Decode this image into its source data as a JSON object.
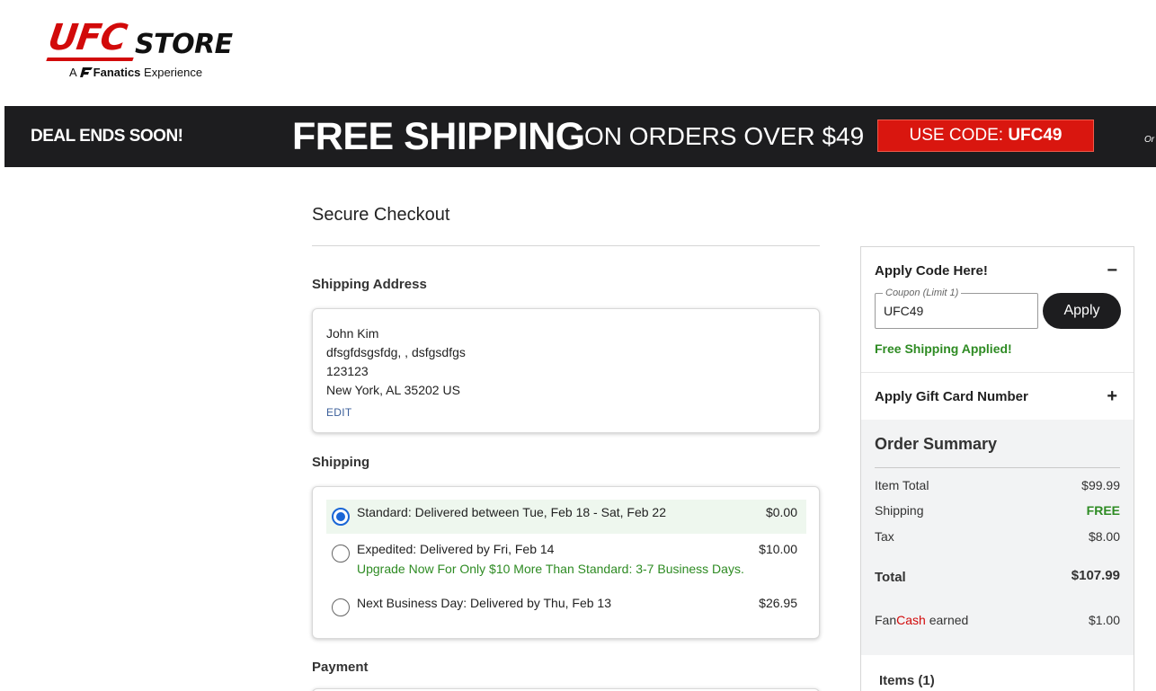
{
  "brand": {
    "logo_main": "UFC",
    "logo_store": "STORE",
    "logo_prefix": "A",
    "logo_partner": "Fanatics",
    "logo_suffix": "Experience"
  },
  "promo": {
    "deal": "DEAL ENDS SOON!",
    "headline": "FREE SHIPPING",
    "subline": "ON ORDERS OVER $49",
    "code_prefix": "USE CODE:",
    "code": "UFC49",
    "overflow_text": "Or"
  },
  "checkout": {
    "title": "Secure Checkout",
    "shipping_address_label": "Shipping Address",
    "address": {
      "name": "John Kim",
      "line1": "dfsgfdsgsfdg, , dsfgsdfgs",
      "line2": "123123",
      "city_line": "New York, AL 35202 US",
      "edit_label": "EDIT"
    },
    "shipping_label": "Shipping",
    "shipping_options": [
      {
        "label": "Standard: Delivered between Tue, Feb 18 - Sat, Feb 22",
        "price": "$0.00",
        "selected": true
      },
      {
        "label": "Expedited: Delivered by Fri, Feb 14",
        "price": "$10.00",
        "note": "Upgrade Now For Only $10 More Than Standard: 3-7 Business Days.",
        "selected": false
      },
      {
        "label": "Next Business Day: Delivered by Thu, Feb 13",
        "price": "$26.95",
        "selected": false
      }
    ],
    "payment_label": "Payment"
  },
  "sidebar": {
    "apply_code": {
      "title": "Apply Code Here!",
      "toggle": "−",
      "coupon_legend": "Coupon (Limit 1)",
      "coupon_value": "UFC49",
      "apply_label": "Apply",
      "success": "Free Shipping Applied!"
    },
    "gift_card": {
      "title": "Apply Gift Card Number",
      "toggle": "+"
    },
    "summary": {
      "title": "Order Summary",
      "item_total_label": "Item Total",
      "item_total": "$99.99",
      "shipping_label": "Shipping",
      "shipping": "FREE",
      "tax_label": "Tax",
      "tax": "$8.00",
      "total_label": "Total",
      "total": "$107.99",
      "fancash_fan": "Fan",
      "fancash_cash": "Cash",
      "fancash_earned": "earned",
      "fancash_value": "$1.00",
      "items_title": "Items (1)"
    }
  },
  "colors": {
    "brand_red": "#d20a0a",
    "banner_bg": "#1d1d1f",
    "code_bg": "#d9160f",
    "success_green": "#2e8b23",
    "radio_blue": "#1a66d6",
    "link_blue": "#3b5f9a"
  },
  "icons": [
    "fanatics-flag-icon",
    "radio-checked-icon",
    "radio-unchecked-icon",
    "minus-icon",
    "plus-icon"
  ]
}
